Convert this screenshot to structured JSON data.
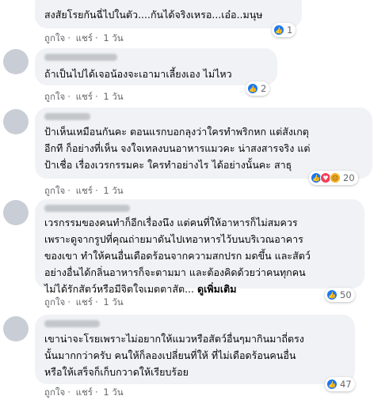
{
  "colors": {
    "bubble": "#f0f2f5",
    "text": "#050505",
    "meta": "#65676b",
    "like": "#1877f2",
    "love": "#f33e58",
    "sad": "#f7b125"
  },
  "actions": {
    "like": "ถูกใจ",
    "reply": "แชร์",
    "sep": "·",
    "time": "1 วัน"
  },
  "comments": [
    {
      "text": "สงสัยโรยกันฉี่ไปในตัว....กันได้จริงเหรอ...เอ๋อ..มนุษ",
      "reactions": [
        "like-icon"
      ],
      "count": "1"
    },
    {
      "text": "ถ้าเป็นไปได้เจอน้องจะเอามาเลี้ยงเอง ไม่ไหว",
      "reactions": [
        "like-icon"
      ],
      "count": "2"
    },
    {
      "text": "ป้าเห็นเหมือนกันคะ ตอนแรกบอกลุงว่าใครทำพริกหก แต่สังเกตุ\nอีกที ก็อย่างที่เห็น จงใจเทลงบนอาหารแมวคะ น่าสงสารจริง แต่\nป้าเชื่อ เรื่องเวรกรรมคะ ใครทำอย่างไร ได้อย่างนั้นคะ สาธุ",
      "reactions": [
        "like-icon",
        "love-icon",
        "sad-icon"
      ],
      "count": "20"
    },
    {
      "text": "เวรกรรมของคนทำก็อีกเรื่องนึง แต่คนที่ให้อาหารก็ไม่สมควร\nเพราะดูจากรูปที่คุณถ่ายมาดันไปเทอาหารไว้บนบริเวณอาคาร\nของเขา ทำให้คนอื่นเดือดร้อนจากความสกปรก มดขึ้น และสัตว์\nอย่างอื่นได้กลิ่นอาหารก็จะตามมา และต้องคิดด้วยว่าคนทุกคน\nไม่ได้รักสัตว์หรือมีจิตใจเมตตาสัต...",
      "see_more": "ดูเพิ่มเติม",
      "reactions": [
        "like-icon"
      ],
      "count": "50"
    },
    {
      "text": "เขาน่าจะโรยเพราะไม่อยากให้แมวหรือสัตว์อื่นๆมากินมาถี่ตรง\nนั้นมากกว่าครับ คนให้ก็ลองเปลี่ยนที่ให้ ที่ไม่เดือดร้อนคนอื่น\nหรือให้เสร็จก็เก็บกวาดให้เรียบร้อย",
      "reactions": [
        "like-icon"
      ],
      "count": "47"
    }
  ]
}
